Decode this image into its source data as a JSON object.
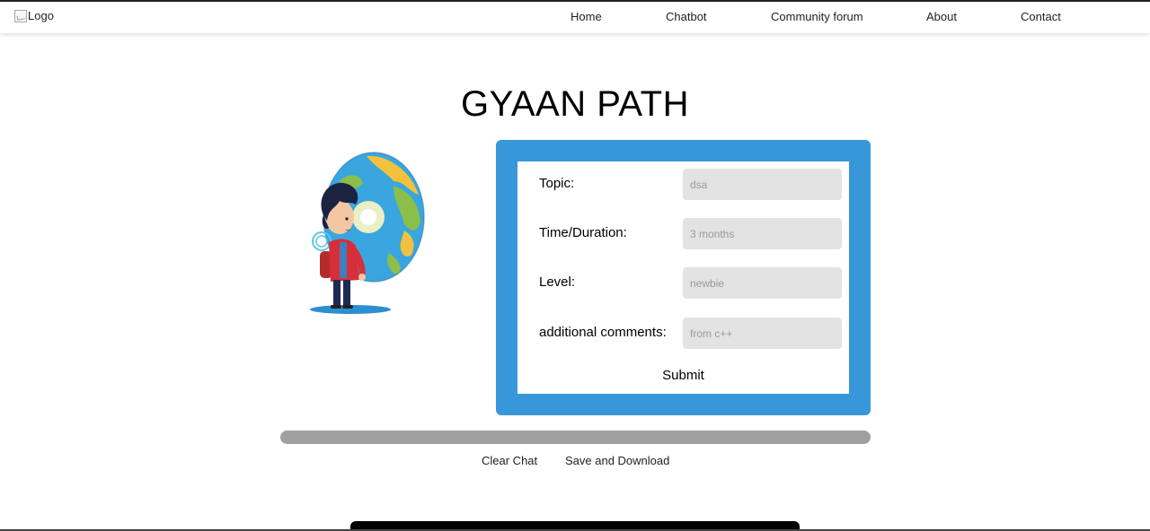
{
  "header": {
    "logo_alt": "Logo",
    "nav": [
      {
        "label": "Home"
      },
      {
        "label": "Chatbot"
      },
      {
        "label": "Community forum"
      },
      {
        "label": "About"
      },
      {
        "label": "Contact"
      }
    ]
  },
  "main": {
    "title": "GYAAN PATH",
    "illustration_icon": "boy-with-globe-lightbulb-illustration"
  },
  "form": {
    "fields": [
      {
        "label": "Topic:",
        "placeholder": "dsa",
        "value": ""
      },
      {
        "label": "Time/Duration:",
        "placeholder": "3 months",
        "value": ""
      },
      {
        "label": "Level:",
        "placeholder": "newbie",
        "value": ""
      },
      {
        "label": "additional comments:",
        "placeholder": "from c++",
        "value": ""
      }
    ],
    "submit_label": "Submit"
  },
  "actions": {
    "clear_label": "Clear Chat",
    "save_label": "Save and Download"
  },
  "colors": {
    "panel": "#3897d9",
    "input_bg": "#e3e3e3",
    "progress_track": "#a0a0a0"
  }
}
